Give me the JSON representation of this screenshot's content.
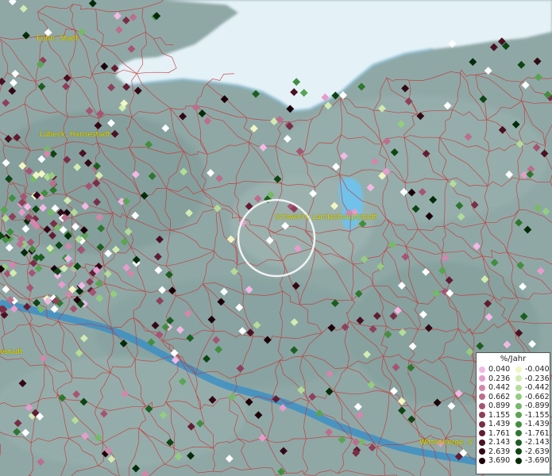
{
  "city_labels": [
    {
      "name": "Eutin, Stadt"
    },
    {
      "name": "Lübeck, Hansestadt"
    },
    {
      "name": "Schwerin, Landeshauptstadt"
    },
    {
      "name": "estadt"
    },
    {
      "name": "Wittenberge, S"
    }
  ],
  "legend": {
    "title": "%/Jahr",
    "positive": [
      {
        "value": "0.040",
        "color": "#f4b8e4"
      },
      {
        "value": "0.236",
        "color": "#e79ccb"
      },
      {
        "value": "0.442",
        "color": "#d287ab"
      },
      {
        "value": "0.662",
        "color": "#bc6e8d"
      },
      {
        "value": "0.899",
        "color": "#a65473"
      },
      {
        "value": "1.155",
        "color": "#8f3f5b"
      },
      {
        "value": "1.439",
        "color": "#792d46"
      },
      {
        "value": "1.761",
        "color": "#621d33"
      },
      {
        "value": "2.143",
        "color": "#4b1122"
      },
      {
        "value": "2.639",
        "color": "#330815"
      },
      {
        "value": "3.690",
        "color": "#1c0208"
      }
    ],
    "negative": [
      {
        "value": "-0.040",
        "color": "#f2f6c2"
      },
      {
        "value": "-0.236",
        "color": "#d2ebb0"
      },
      {
        "value": "-0.442",
        "color": "#b3dc98"
      },
      {
        "value": "-0.662",
        "color": "#94cc80"
      },
      {
        "value": "-0.899",
        "color": "#76b968"
      },
      {
        "value": "-1.155",
        "color": "#5aa452"
      },
      {
        "value": "-1.439",
        "color": "#428e3f"
      },
      {
        "value": "-1.761",
        "color": "#2d772e"
      },
      {
        "value": "-2.143",
        "color": "#1b5e1f"
      },
      {
        "value": "-2.639",
        "color": "#0d4513"
      },
      {
        "value": "-3.690",
        "color": "#042c08"
      }
    ]
  },
  "colors": {
    "land": "#8fa8a6",
    "sea": "#e4f2f8",
    "river": "#3d8fc4",
    "lake": "#6fc2ea",
    "boundaries": "#c83232",
    "label_text": "#e8e000",
    "highlight_ring": "#f2f2f2"
  }
}
